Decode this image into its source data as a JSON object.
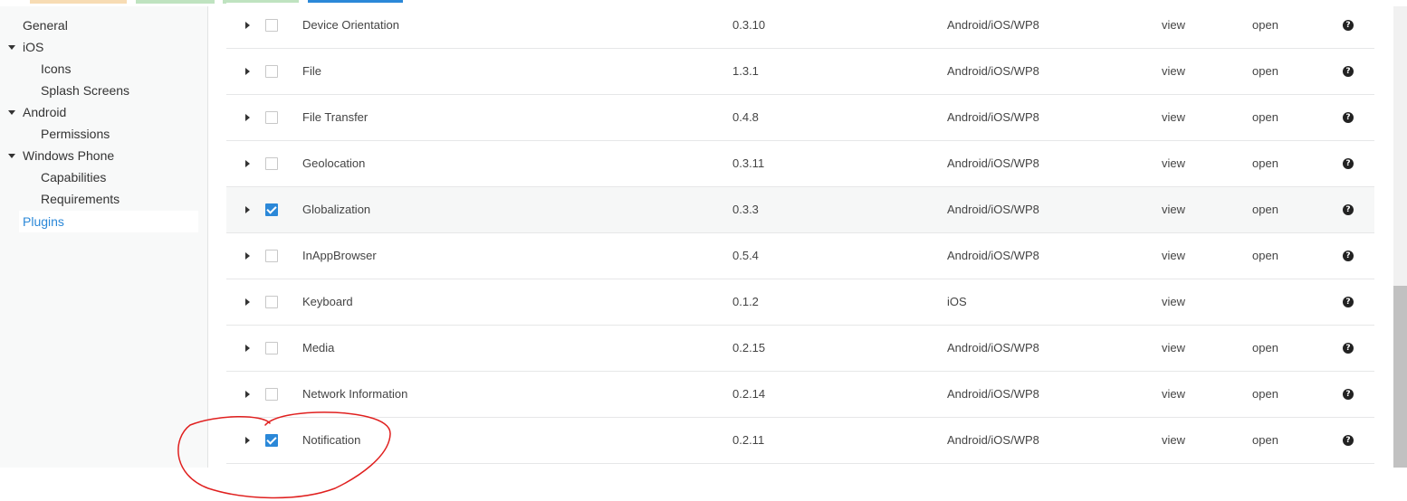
{
  "tab_strip": {
    "colors": [
      "#f7dcb4",
      "#bfe3c0",
      "#bfe3c0",
      "#2b88d8"
    ]
  },
  "sidebar": {
    "items": [
      {
        "label": "General",
        "level": 0
      },
      {
        "label": "iOS",
        "level": 0,
        "expandable": true
      },
      {
        "label": "Icons",
        "level": 1
      },
      {
        "label": "Splash Screens",
        "level": 1
      },
      {
        "label": "Android",
        "level": 0,
        "expandable": true
      },
      {
        "label": "Permissions",
        "level": 1
      },
      {
        "label": "Windows Phone",
        "level": 0,
        "expandable": true
      },
      {
        "label": "Capabilities",
        "level": 1
      },
      {
        "label": "Requirements",
        "level": 1
      },
      {
        "label": "Plugins",
        "level": 0,
        "active": true
      }
    ]
  },
  "plugins": {
    "rows": [
      {
        "name": "Device Orientation",
        "version": "0.3.10",
        "platforms": "Android/iOS/WP8",
        "view": "view",
        "open": "open",
        "checked": false
      },
      {
        "name": "File",
        "version": "1.3.1",
        "platforms": "Android/iOS/WP8",
        "view": "view",
        "open": "open",
        "checked": false
      },
      {
        "name": "File Transfer",
        "version": "0.4.8",
        "platforms": "Android/iOS/WP8",
        "view": "view",
        "open": "open",
        "checked": false
      },
      {
        "name": "Geolocation",
        "version": "0.3.11",
        "platforms": "Android/iOS/WP8",
        "view": "view",
        "open": "open",
        "checked": false
      },
      {
        "name": "Globalization",
        "version": "0.3.3",
        "platforms": "Android/iOS/WP8",
        "view": "view",
        "open": "open",
        "checked": true
      },
      {
        "name": "InAppBrowser",
        "version": "0.5.4",
        "platforms": "Android/iOS/WP8",
        "view": "view",
        "open": "open",
        "checked": false
      },
      {
        "name": "Keyboard",
        "version": "0.1.2",
        "platforms": "iOS",
        "view": "view",
        "open": "",
        "checked": false
      },
      {
        "name": "Media",
        "version": "0.2.15",
        "platforms": "Android/iOS/WP8",
        "view": "view",
        "open": "open",
        "checked": false
      },
      {
        "name": "Network Information",
        "version": "0.2.14",
        "platforms": "Android/iOS/WP8",
        "view": "view",
        "open": "open",
        "checked": false
      },
      {
        "name": "Notification",
        "version": "0.2.11",
        "platforms": "Android/iOS/WP8",
        "view": "view",
        "open": "open",
        "checked": true
      }
    ],
    "help_icon": "question-circle-icon",
    "expander_icon": "caret-right-icon"
  },
  "colors": {
    "accent": "#2b88d8",
    "row_highlight": "#f6f7f7",
    "annotation": "#e0201f"
  }
}
